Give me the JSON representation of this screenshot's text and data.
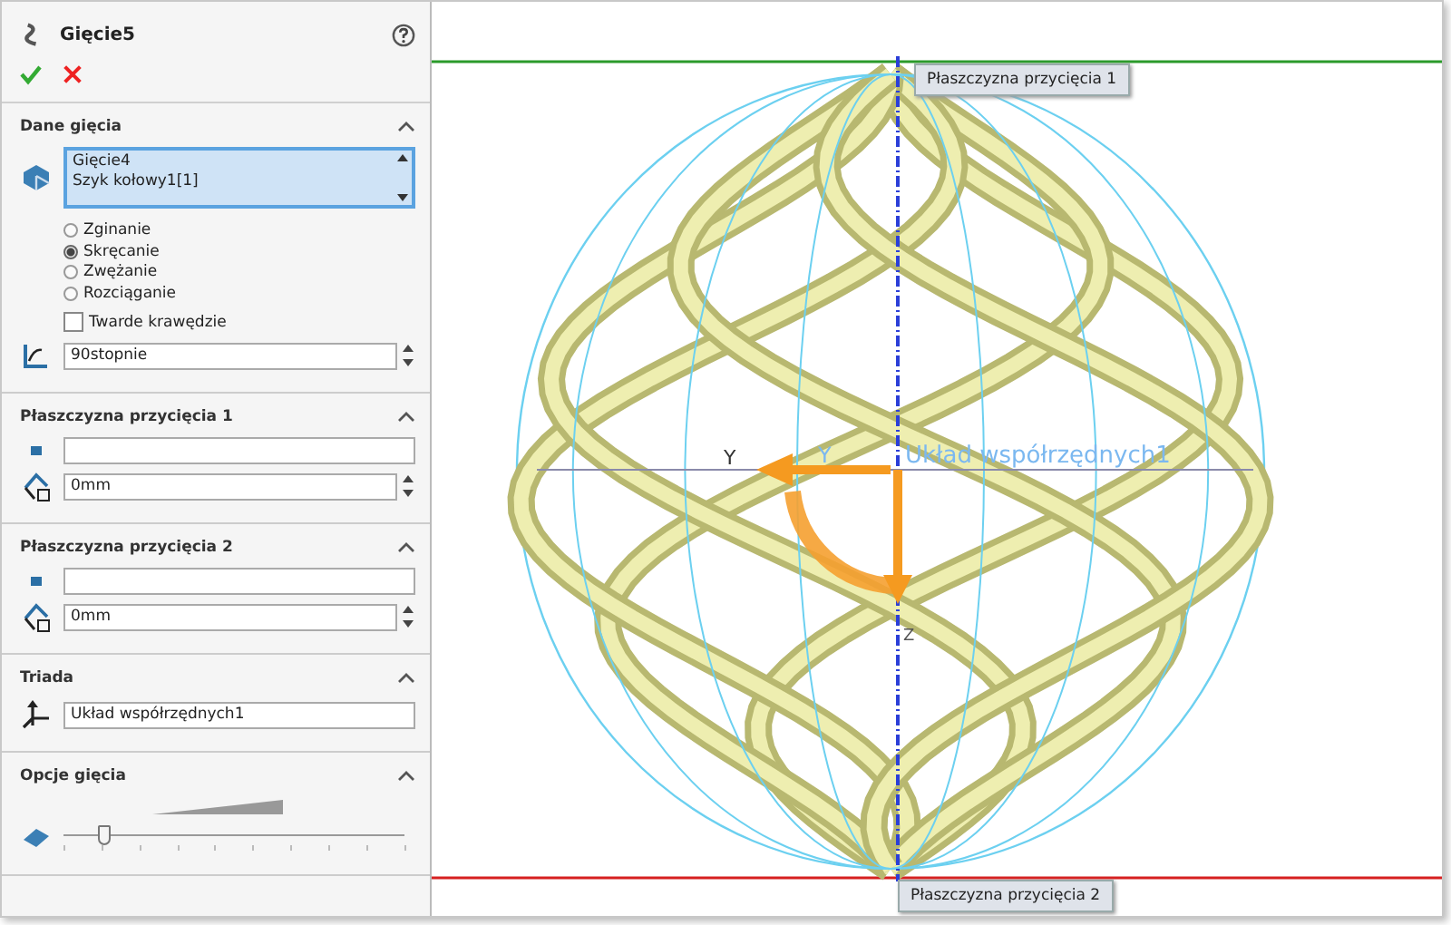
{
  "panel": {
    "title": "Gięcie5"
  },
  "sections": [
    {
      "kind": "bend",
      "title": "Dane gięcia",
      "expanded": true,
      "list": [
        "Gięcie4",
        "Szyk kołowy1[1]"
      ],
      "options": [
        {
          "label": "Zginanie",
          "selected": false
        },
        {
          "label": "Skręcanie",
          "selected": true
        },
        {
          "label": "Zwężanie",
          "selected": false
        },
        {
          "label": "Rozciąganie",
          "selected": false
        }
      ],
      "checkbox": {
        "label": "Twarde krawędzie",
        "checked": false
      },
      "angle": "90stopnie"
    },
    {
      "kind": "plane",
      "title": "Płaszczyzna przycięcia 1",
      "expanded": true,
      "distance": "0mm"
    },
    {
      "kind": "plane",
      "title": "Płaszczyzna przycięcia 2",
      "expanded": true,
      "distance": "0mm"
    },
    {
      "kind": "triad",
      "title": "Triada",
      "expanded": true,
      "value": "Układ współrzędnych1"
    },
    {
      "kind": "options",
      "title": "Opcje gięcia",
      "expanded": true,
      "slider": {
        "level": 0.12
      }
    }
  ],
  "viewport": {
    "plane_label_1": "Płaszczyzna przycięcia 1",
    "plane_label_2": "Płaszczyzna przycięcia 2",
    "axis_y_dark": "Y",
    "axis_y_light": "Y",
    "axis_z": "Z",
    "coordinate_system": "Układ współrzędnych1"
  }
}
